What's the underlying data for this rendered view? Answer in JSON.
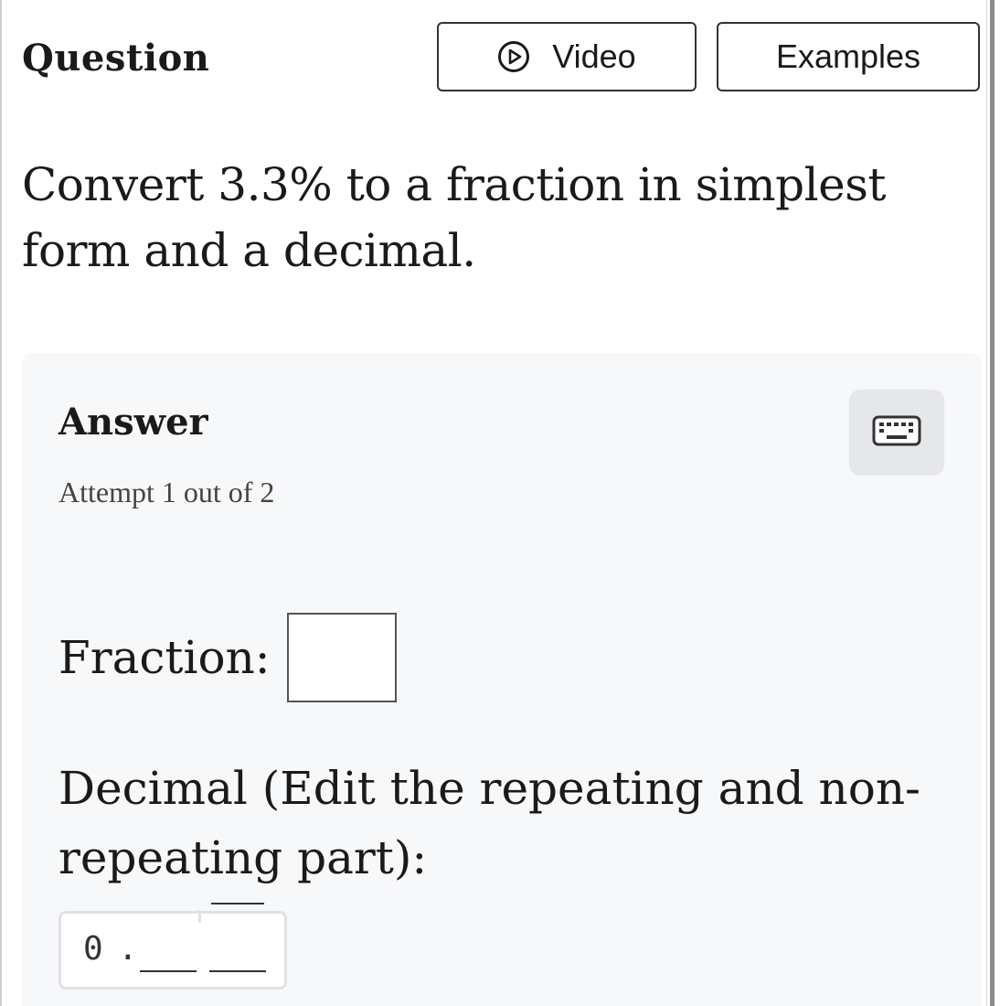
{
  "header": {
    "title": "Question",
    "video_label": "Video",
    "examples_label": "Examples"
  },
  "question": {
    "text": "Convert 3.3% to a fraction in simplest form and a decimal."
  },
  "answer": {
    "title": "Answer",
    "attempt": "Attempt 1 out of 2",
    "fraction_label": "Fraction:",
    "fraction_value": "",
    "decimal_label": "Decimal (Edit the repeating and non-repeating part):",
    "decimal_prefix": "0",
    "decimal_point": ".",
    "nonrepeating_value": "",
    "repeating_value": ""
  },
  "icons": {
    "play": "play-circle-icon",
    "keyboard": "keyboard-icon"
  },
  "colors": {
    "panel_bg": "#f7f8fa",
    "keyboard_bg": "#e6e7ea",
    "border": "#333333"
  }
}
